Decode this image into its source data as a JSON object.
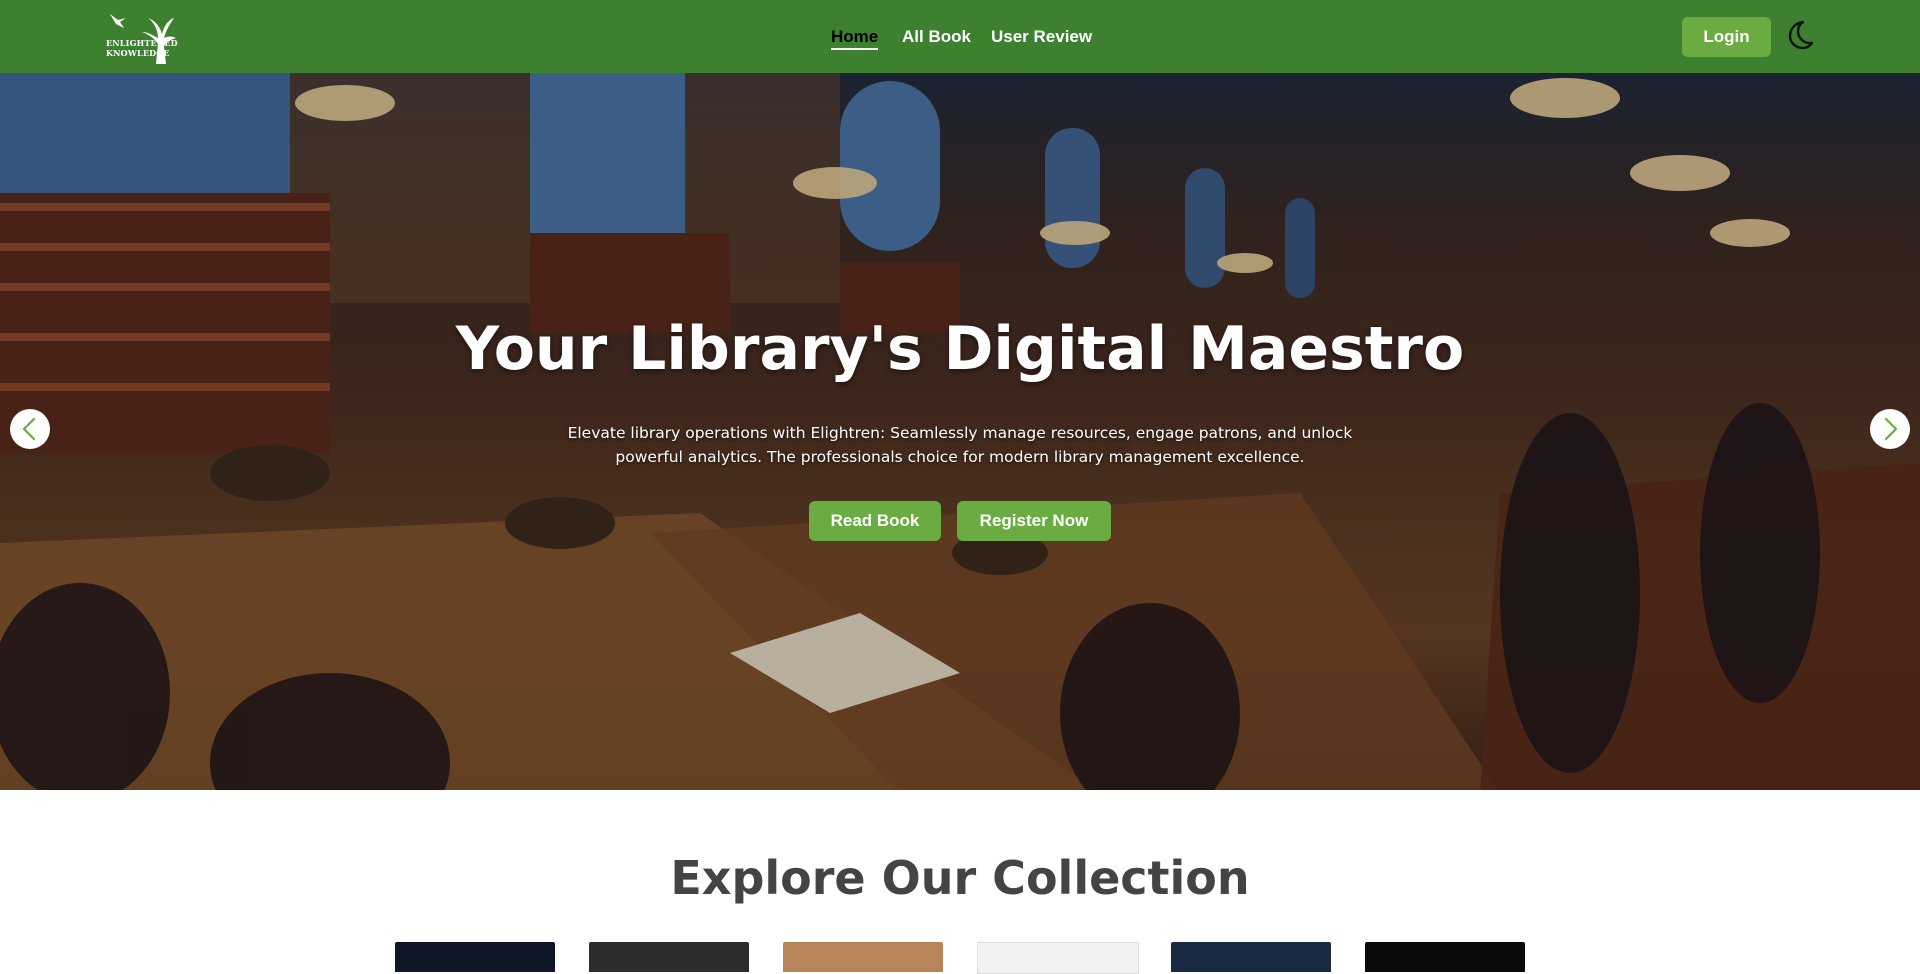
{
  "header": {
    "logo_line1": "ENLIGHTENED",
    "logo_line2": "KNOWLEDGE",
    "nav": [
      {
        "label": "Home",
        "active": true
      },
      {
        "label": "All Book",
        "active": false
      },
      {
        "label": "User Review",
        "active": false
      }
    ],
    "login_label": "Login",
    "theme_icon": "moon-icon"
  },
  "hero": {
    "title": "Your Library's Digital Maestro",
    "description": "Elevate library operations with Elightren: Seamlessly manage resources, engage patrons, and unlock powerful analytics. The professionals choice for modern library management excellence.",
    "read_label": "Read Book",
    "register_label": "Register Now",
    "prev_icon": "chevron-left-icon",
    "next_icon": "chevron-right-icon"
  },
  "collection": {
    "title": "Explore Our Collection"
  },
  "colors": {
    "navbar": "#3d8030",
    "button": "#6aac42",
    "heading": "#444444"
  }
}
